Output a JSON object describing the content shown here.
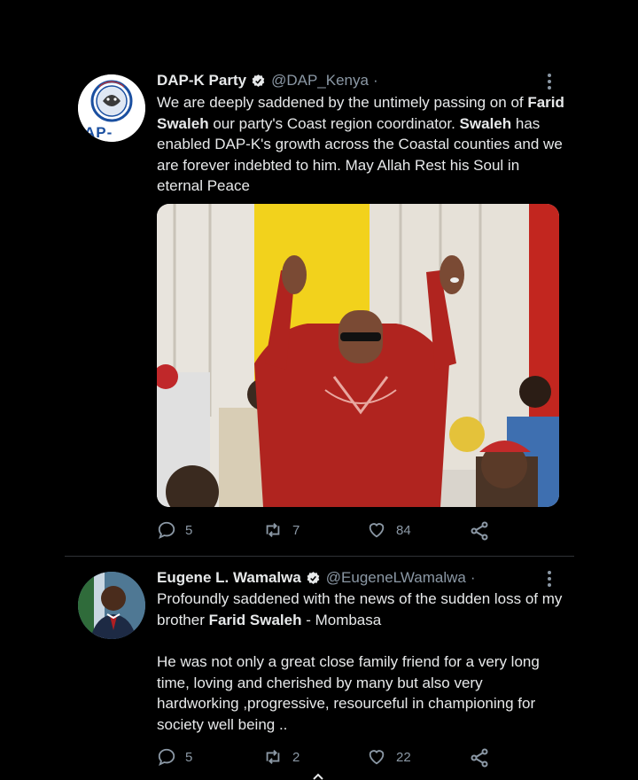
{
  "tweets": [
    {
      "name": "DAP-K Party",
      "handle": "@DAP_Kenya",
      "separator": "·",
      "avatar_text": "AP-",
      "body_parts": {
        "p1": "We are deeply saddened by the untimely passing on of ",
        "b1": "Farid Swaleh",
        "p2": " our party's Coast region coordinator. ",
        "b2": "Swaleh",
        "p3": " has enabled DAP-K's growth across the Coastal counties and we are forever indebted to him. May Allah Rest his Soul in eternal Peace"
      },
      "replies": "5",
      "retweets": "7",
      "likes": "84"
    },
    {
      "name": "Eugene L. Wamalwa",
      "handle": "@EugeneLWamalwa",
      "separator": "·",
      "body_parts": {
        "p1": "Profoundly saddened with the news of the sudden loss of my brother ",
        "b1": "Farid Swaleh",
        "p2": " - Mombasa",
        "p3": "He was not only a great close family friend for a very long time, loving and cherished by many but also very hardworking ,progressive, resourceful in championing for society well being .."
      },
      "replies": "5",
      "retweets": "2",
      "likes": "22"
    }
  ],
  "colors": {
    "background": "#000000",
    "text": "#e7e9ea",
    "muted": "#8b98a5",
    "divider": "#2f3336",
    "logo_blue": "#1a4fa0"
  },
  "icons": [
    "verified-badge-icon",
    "more-options-icon",
    "reply-icon",
    "retweet-icon",
    "like-icon",
    "share-icon"
  ]
}
